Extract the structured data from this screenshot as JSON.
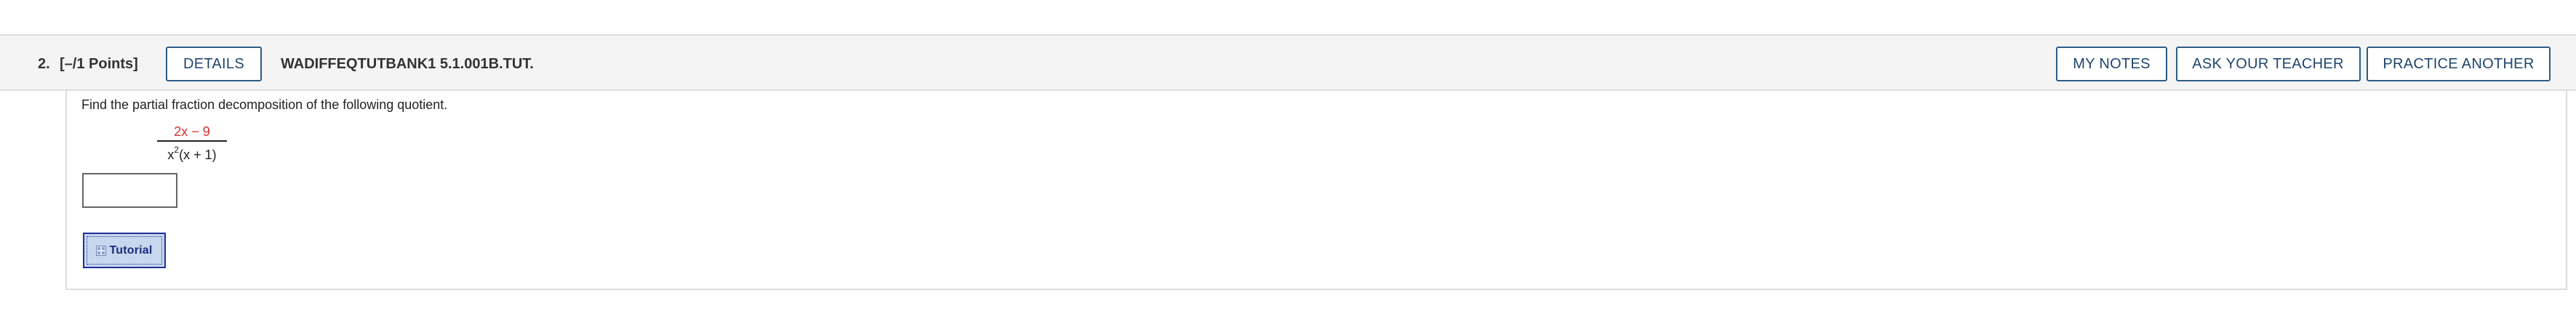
{
  "question": {
    "number": "2.",
    "points": "[–/1 Points]",
    "code": "WADIFFEQTUTBANK1 5.1.001B.TUT."
  },
  "header_buttons": {
    "details": "DETAILS",
    "my_notes": "MY NOTES",
    "ask_teacher": "ASK YOUR TEACHER",
    "practice_another": "PRACTICE ANOTHER"
  },
  "body": {
    "prompt": "Find the partial fraction decomposition of the following quotient.",
    "numerator": "2x − 9",
    "denominator_base": "x",
    "denominator_exponent": "2",
    "denominator_rest": "(x + 1)",
    "answer_value": "",
    "tutorial_label": "Tutorial",
    "tutorial_icon": "tutorial-icon"
  },
  "colors": {
    "button_border": "#2d5c88",
    "header_background": "#f4f4f4",
    "numerator_color": "#d32f2f",
    "tutorial_background": "#c9d7ee",
    "tutorial_border": "#1f2f99"
  }
}
